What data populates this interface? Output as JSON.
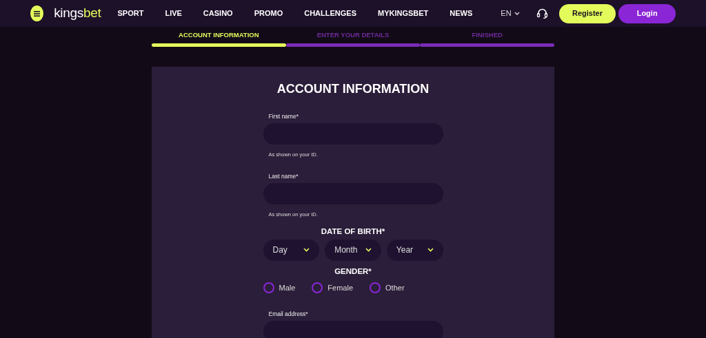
{
  "header": {
    "logo": {
      "lead": "kings",
      "accent": "bet"
    },
    "nav": [
      {
        "label": "SPORT"
      },
      {
        "label": "LIVE"
      },
      {
        "label": "CASINO"
      },
      {
        "label": "PROMO"
      },
      {
        "label": "CHALLENGES"
      },
      {
        "label": "MYKINGSBET"
      },
      {
        "label": "NEWS"
      }
    ],
    "language": "EN",
    "register": "Register",
    "login": "Login"
  },
  "steps": [
    {
      "label": "ACCOUNT INFORMATION",
      "selected": true
    },
    {
      "label": "ENTER YOUR DETAILS",
      "selected": false
    },
    {
      "label": "FINISHED",
      "selected": false
    }
  ],
  "form": {
    "title": "ACCOUNT INFORMATION",
    "fields": [
      {
        "kind": "text",
        "label": "First name*",
        "hint": "As shown on your ID."
      },
      {
        "kind": "text",
        "label": "Last name*",
        "hint": "As shown on your ID."
      },
      {
        "kind": "date",
        "label": "DATE OF BIRTH*",
        "selects": [
          {
            "placeholder": "Day"
          },
          {
            "placeholder": "Month"
          },
          {
            "placeholder": "Year"
          }
        ]
      },
      {
        "kind": "radio",
        "label": "GENDER*",
        "options": [
          {
            "label": "Male",
            "selected": false
          },
          {
            "label": "Female",
            "selected": false
          },
          {
            "label": "Other",
            "selected": false
          }
        ]
      },
      {
        "kind": "text",
        "label": "Email address*"
      }
    ]
  }
}
